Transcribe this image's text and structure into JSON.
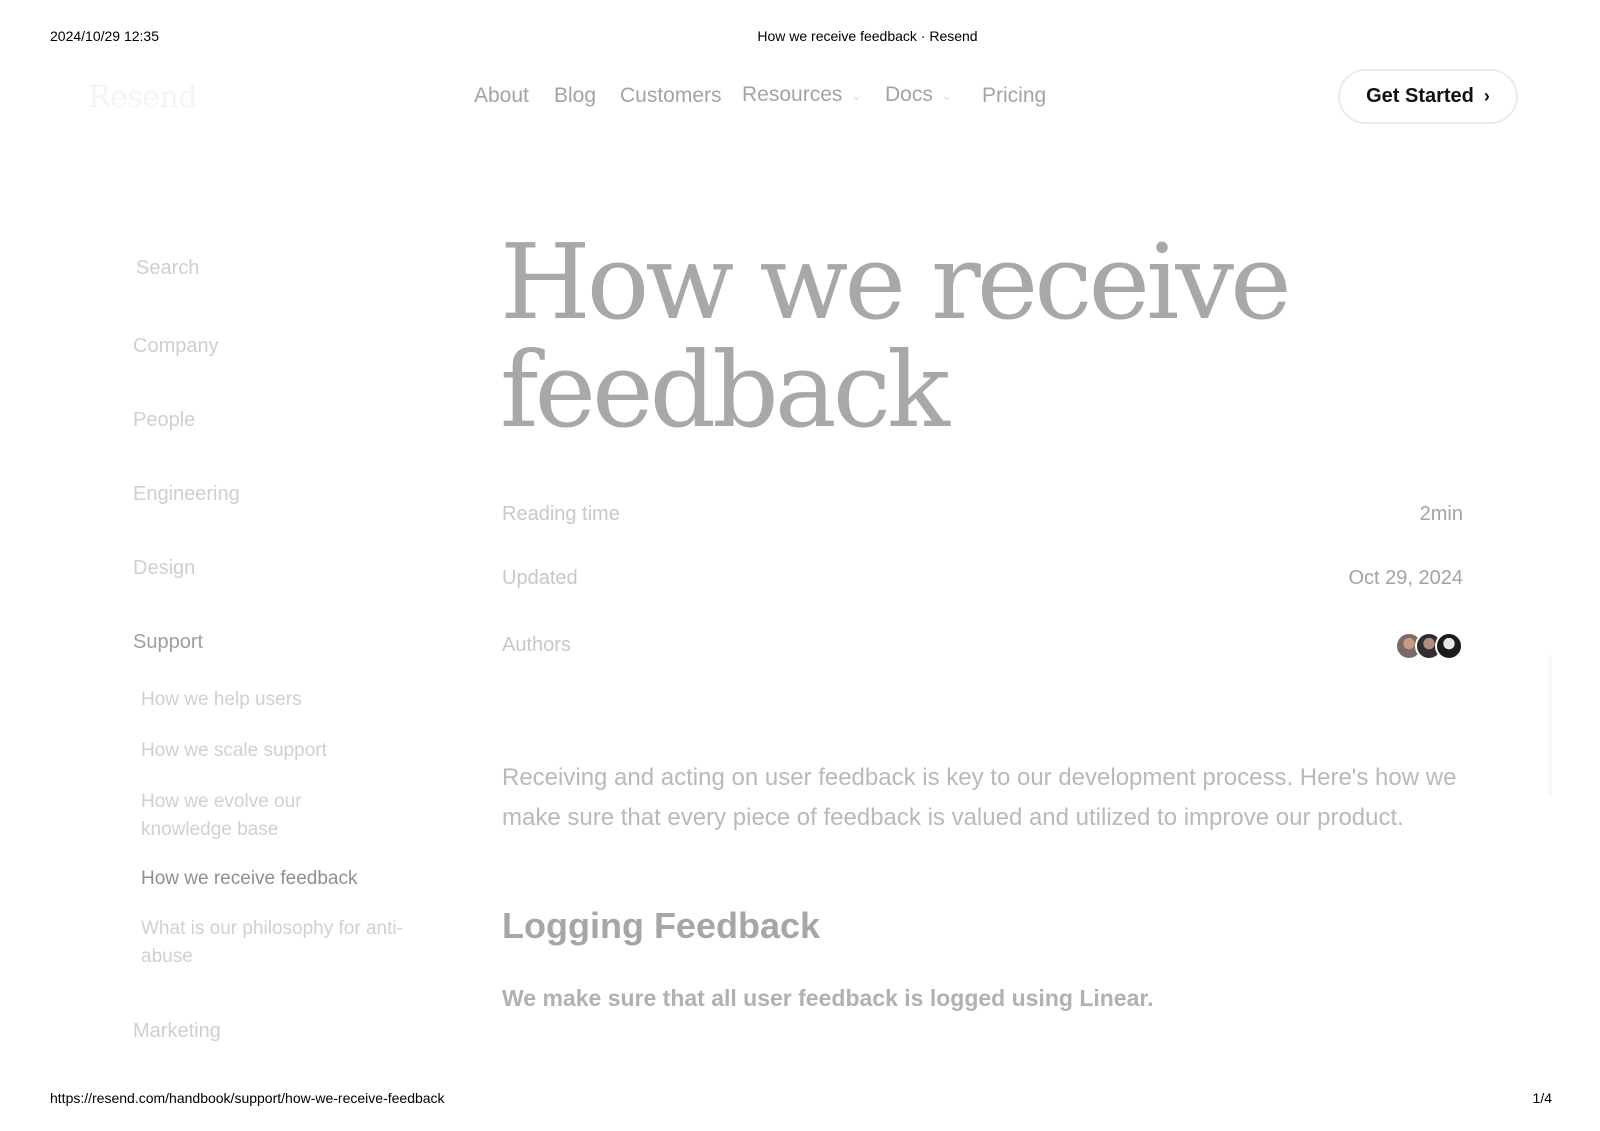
{
  "print": {
    "datetime": "2024/10/29 12:35",
    "doc_title": "How we receive feedback · Resend",
    "url": "https://resend.com/handbook/support/how-we-receive-feedback",
    "page": "1/4"
  },
  "header": {
    "logo": "Resend",
    "nav": [
      {
        "label": "About"
      },
      {
        "label": "Blog"
      },
      {
        "label": "Customers"
      },
      {
        "label": "Resources",
        "has_dropdown": true
      },
      {
        "label": "Docs",
        "has_dropdown": true
      },
      {
        "label": "Pricing"
      }
    ],
    "cta_label": "Get Started"
  },
  "sidebar": {
    "search_label": "Search",
    "sections": [
      {
        "label": "Company"
      },
      {
        "label": "People"
      },
      {
        "label": "Engineering"
      },
      {
        "label": "Design"
      },
      {
        "label": "Support",
        "expanded": true
      },
      {
        "label": "Marketing"
      }
    ],
    "support_items": [
      {
        "label": "How we help users"
      },
      {
        "label": "How we scale support"
      },
      {
        "label": "How we evolve our knowledge base"
      },
      {
        "label": "How we receive feedback",
        "active": true
      },
      {
        "label": "What is our philosophy for anti-abuse"
      }
    ]
  },
  "article": {
    "title": "How we receive feedback",
    "meta": {
      "reading_time_label": "Reading time",
      "reading_time_value": "2min",
      "updated_label": "Updated",
      "updated_value": "Oct 29, 2024",
      "authors_label": "Authors",
      "authors_count": 3
    },
    "intro": "Receiving and acting on user feedback is key to our development process. Here's how we make sure that every piece of feedback is valued and utilized to improve our product.",
    "section_heading": "Logging Feedback",
    "section_lead": "We make sure that all user feedback is logged using Linear."
  },
  "icons": {
    "dropdown": "chevron-down-icon",
    "cta": "chevron-right-icon"
  }
}
